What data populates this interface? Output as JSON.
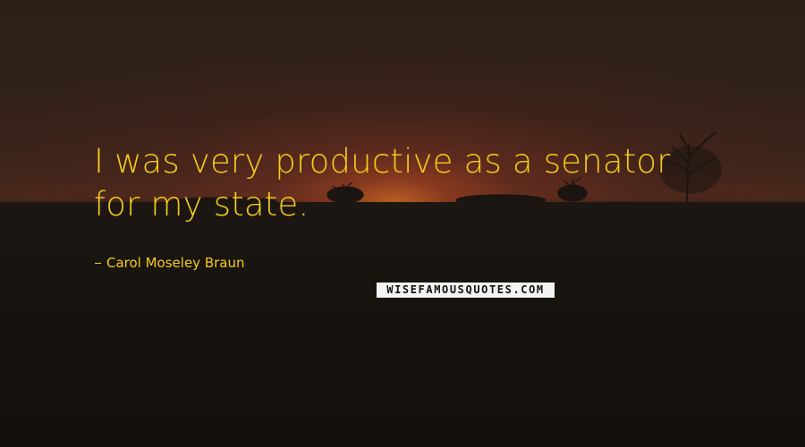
{
  "quote": {
    "line1": "I was very productive as a senator",
    "line2": "for my state."
  },
  "author": {
    "name": "Carol Moseley Braun"
  },
  "watermark": {
    "text": "WISEFAMOUSQUOTES.COM"
  },
  "colors": {
    "text": "#f5cc1b",
    "background": "#1a1410",
    "sun_glow": "#ff8c28"
  }
}
